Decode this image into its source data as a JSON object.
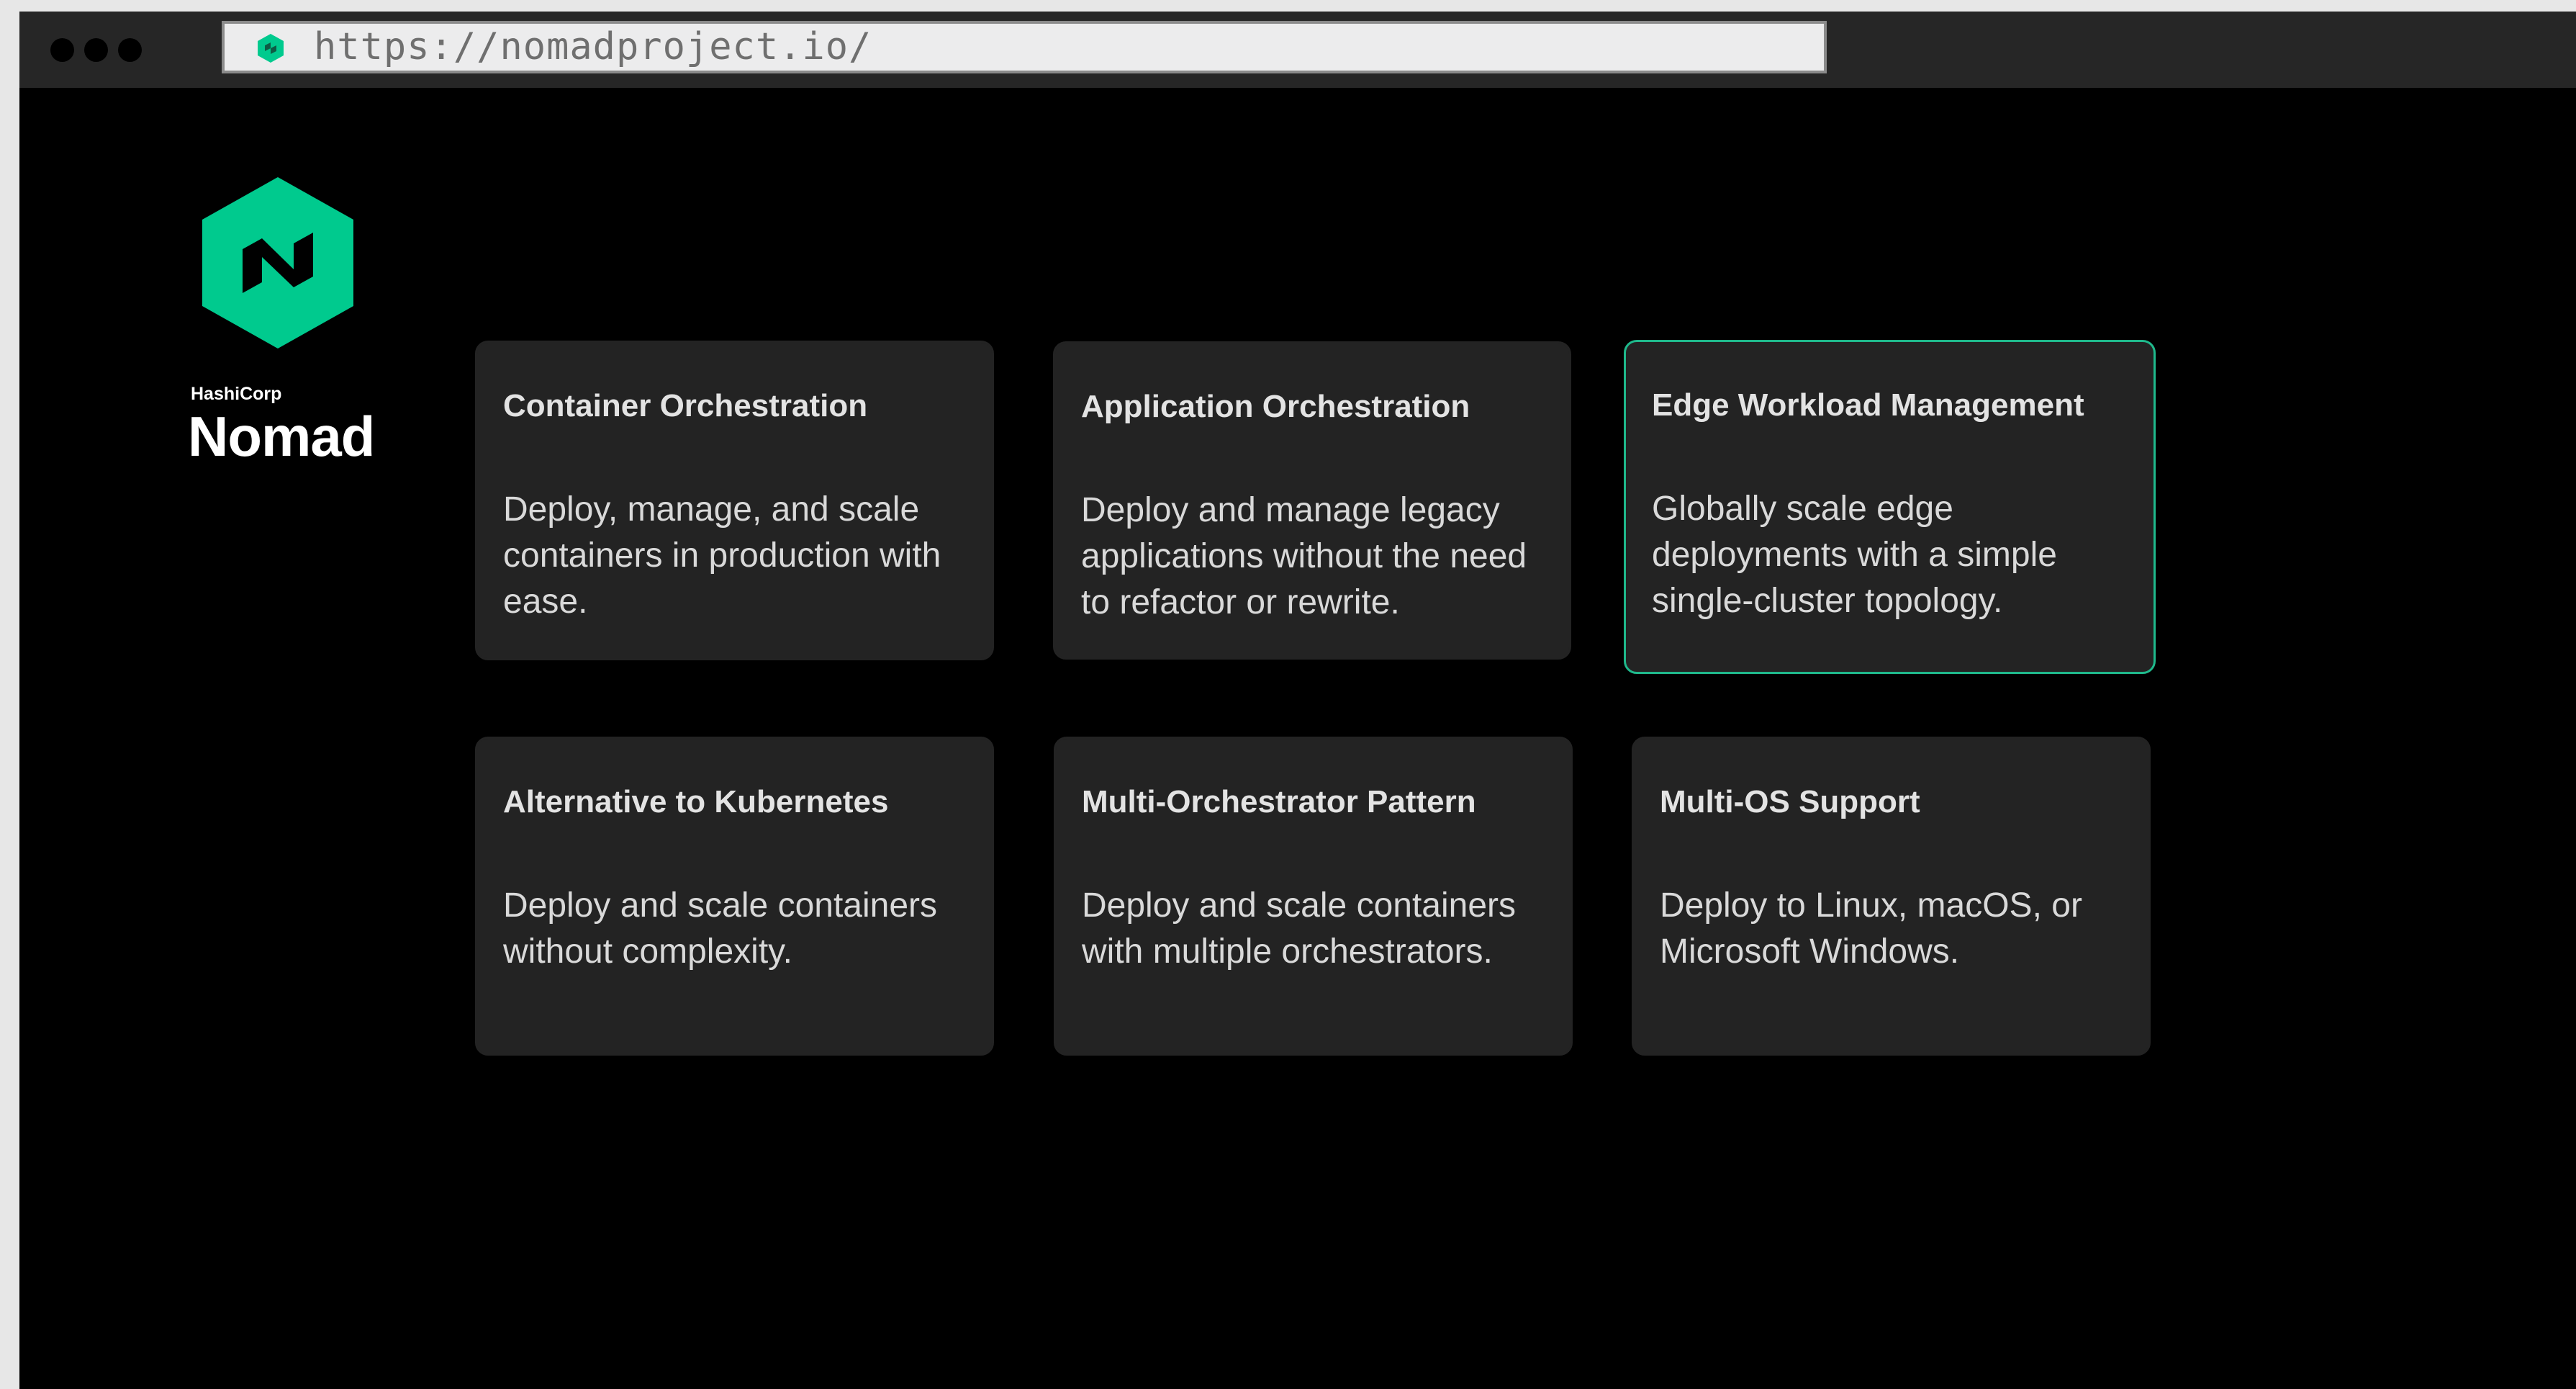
{
  "browser": {
    "url": "https://nomadproject.io/",
    "accent_color": "#1fb98c"
  },
  "logo": {
    "company": "HashiCorp",
    "product": "Nomad",
    "icon": "nomad-hexagon-logo-icon",
    "color": "#00ca8e"
  },
  "cards": [
    {
      "title": "Container Orchestration",
      "description": "Deploy, manage, and scale containers in production with ease."
    },
    {
      "title": "Application Orchestration",
      "description": "Deploy and manage legacy applications without the need to refactor or rewrite."
    },
    {
      "title": "Edge Workload Management",
      "description": "Globally scale edge deployments with a simple single-cluster topology."
    },
    {
      "title": "Alternative to Kubernetes",
      "description": "Deploy and scale containers without complexity."
    },
    {
      "title": "Multi-Orchestrator Pattern",
      "description": "Deploy and scale containers with multiple orchestrators."
    },
    {
      "title": "Multi-OS Support",
      "description": "Deploy to Linux, macOS, or Microsoft Windows."
    }
  ]
}
